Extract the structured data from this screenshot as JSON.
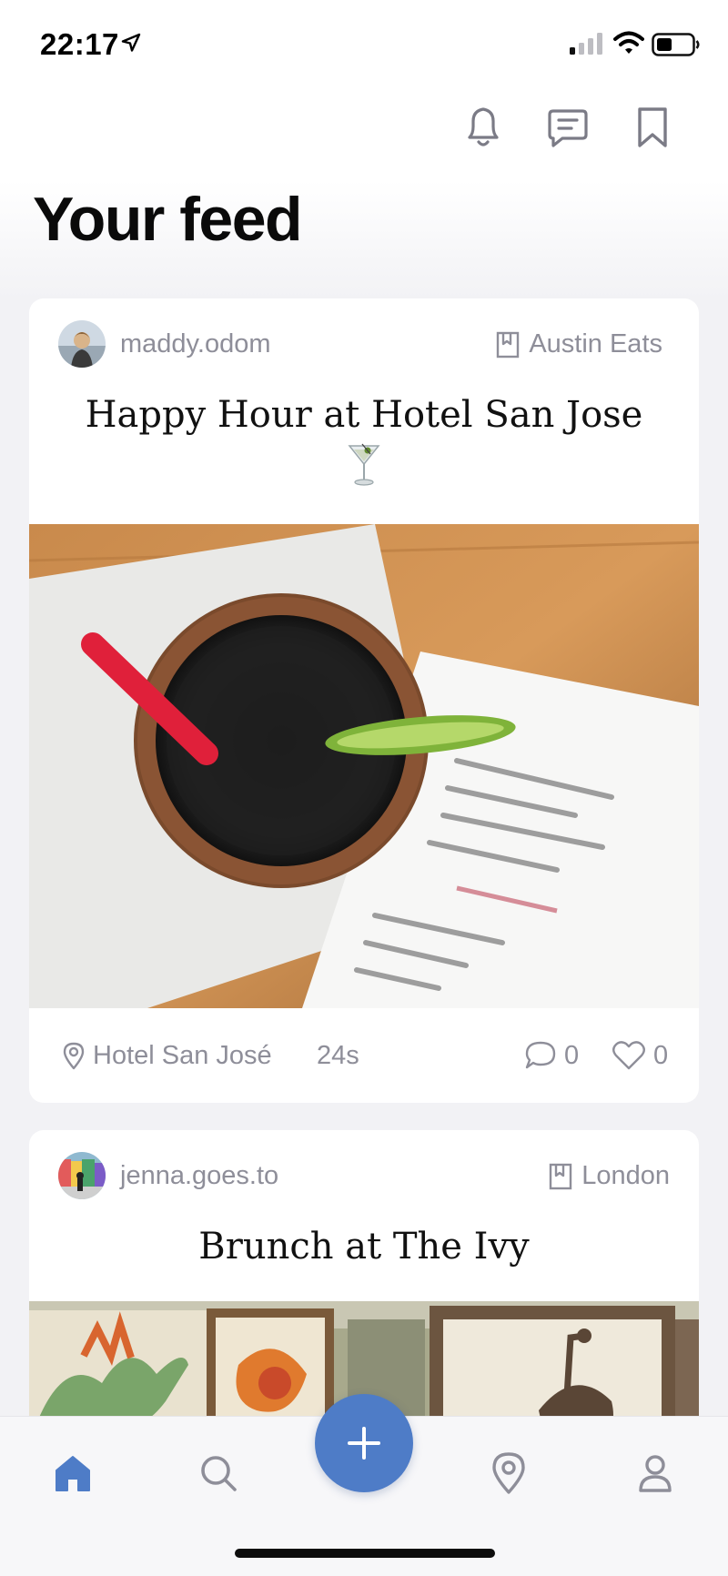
{
  "status_bar": {
    "time": "22:17",
    "icons": [
      "location-arrow-icon",
      "cellular-signal-icon",
      "wifi-icon",
      "battery-icon"
    ]
  },
  "header": {
    "icons": [
      "bell-icon",
      "message-icon",
      "bookmark-icon"
    ],
    "title": "Your feed"
  },
  "posts": [
    {
      "username": "maddy.odom",
      "collection": "Austin Eats",
      "title": "Happy Hour at Hotel San Jose",
      "emoji": "🍸",
      "place": "Hotel San José",
      "time_ago": "24s",
      "comments": "0",
      "likes": "0"
    },
    {
      "username": "jenna.goes.to",
      "collection": "London",
      "title": "Brunch at The Ivy"
    }
  ],
  "tab_bar": {
    "items": [
      "home-icon",
      "search-icon",
      "add-icon",
      "map-pin-icon",
      "profile-icon"
    ],
    "active": "home",
    "accent": "#4e7cc7"
  },
  "colors": {
    "accent": "#4e7cc7",
    "muted_text": "#8e8e99",
    "background": "#f2f2f5"
  }
}
